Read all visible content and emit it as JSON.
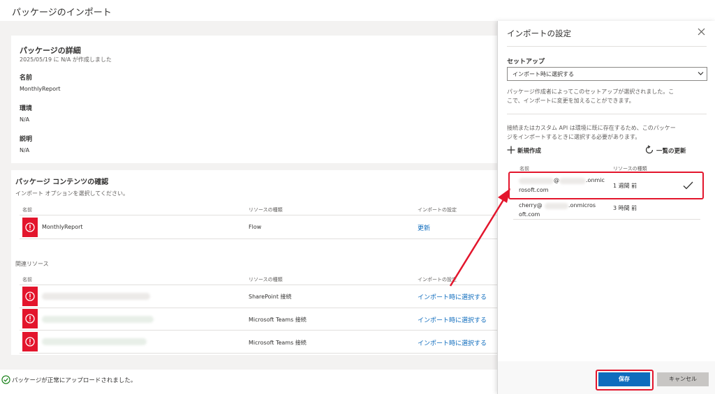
{
  "page_title": "パッケージのインポート",
  "details": {
    "heading": "パッケージの詳細",
    "created": "2025/05/19 に N/A が作成しました",
    "name_label": "名前",
    "name_value": "MonthlyReport",
    "env_label": "環境",
    "env_value": "N/A",
    "desc_label": "説明",
    "desc_value": "N/A"
  },
  "contents": {
    "heading": "パッケージ コンテンツの確認",
    "subtitle": "インポート オプションを選択してください。",
    "col_name": "名前",
    "col_type": "リソースの種類",
    "col_setting": "インポートの設定",
    "rows": [
      {
        "name": "MonthlyReport",
        "type": "Flow",
        "setting": "更新"
      }
    ]
  },
  "related": {
    "heading": "関連リソース",
    "col_name": "名前",
    "col_type": "リソースの種類",
    "col_setting": "インポートの設定",
    "rows": [
      {
        "type": "SharePoint 接続",
        "setting": "インポート時に選択する"
      },
      {
        "type": "Microsoft Teams 接続",
        "setting": "インポート時に選択する"
      },
      {
        "type": "Microsoft Teams 接続",
        "setting": "インポート時に選択する"
      }
    ]
  },
  "status": {
    "text": "パッケージが正常にアップロードされました。"
  },
  "panel": {
    "title": "インポートの設定",
    "setup_label": "セットアップ",
    "select_value": "インポート時に選択する",
    "desc1_l1": "パッケージ作成者によってこのセットアップが選択されました。こ",
    "desc1_l2": "こで、インポートに変更を加えることができます。",
    "desc2_l1": "接続またはカスタム API は環境に既に存在するため、このパッケー",
    "desc2_l2": "ジをインポートするときに選択する必要があります。",
    "new_label": "新規作成",
    "refresh_label": "一覧の更新",
    "col_name": "名前",
    "col_type": "リソースの種類",
    "connections": [
      {
        "l1_at": "@",
        "l1_tail": ".onmic",
        "l2": "rosoft.com",
        "time": "1 週間 前"
      },
      {
        "l1_head": "cherry@",
        "l1_tail": ".onmicros",
        "l2": "oft.com",
        "time": "3 時間 前"
      }
    ],
    "save_label": "保存",
    "cancel_label": "キャンセル"
  },
  "colors": {
    "accent": "#0f6cbd",
    "error": "#e3152c",
    "highlight": "#e3152c",
    "success": "#107c10"
  }
}
